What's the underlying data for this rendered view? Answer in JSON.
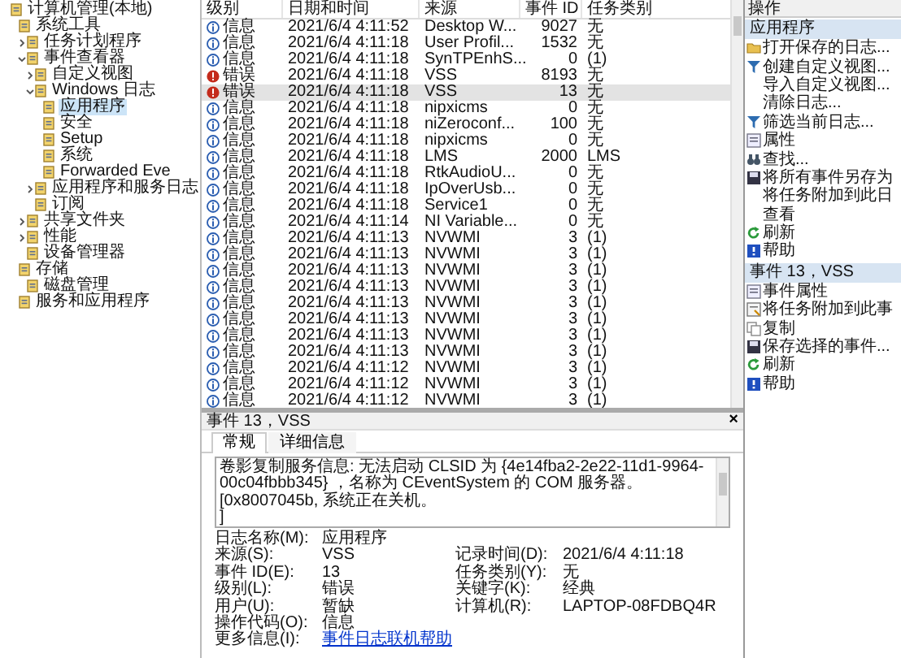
{
  "tree": [
    {
      "label": "计算机管理(本地)",
      "selected": false,
      "children": [
        {
          "label": "系统工具",
          "selected": false,
          "children": [
            {
              "label": "任务计划程序",
              "expanded": false,
              "selected": false
            },
            {
              "label": "事件查看器",
              "expanded": true,
              "selected": false,
              "children": [
                {
                  "label": "自定义视图",
                  "expanded": false,
                  "selected": false
                },
                {
                  "label": "Windows 日志",
                  "expanded": true,
                  "selected": false,
                  "children": [
                    {
                      "label": "应用程序",
                      "selected": true
                    },
                    {
                      "label": "安全",
                      "selected": false
                    },
                    {
                      "label": "Setup",
                      "selected": false
                    },
                    {
                      "label": "系统",
                      "selected": false
                    },
                    {
                      "label": "Forwarded Eve",
                      "selected": false
                    }
                  ]
                },
                {
                  "label": "应用程序和服务日志",
                  "expanded": false,
                  "selected": false
                },
                {
                  "label": "订阅",
                  "selected": false
                }
              ]
            },
            {
              "label": "共享文件夹",
              "expanded": false,
              "selected": false
            },
            {
              "label": "性能",
              "expanded": false,
              "selected": false
            },
            {
              "label": "设备管理器",
              "selected": false
            }
          ]
        },
        {
          "label": "存储",
          "selected": false,
          "children": [
            {
              "label": "磁盘管理",
              "selected": false
            }
          ]
        },
        {
          "label": "服务和应用程序",
          "selected": false
        }
      ]
    }
  ],
  "events": {
    "columns": [
      "级别",
      "日期和时间",
      "来源",
      "事件 ID",
      "任务类别"
    ],
    "rows": [
      {
        "kind": "info",
        "level": "信息",
        "time": "2021/6/4 4:11:52",
        "source": "Desktop W...",
        "id": "9027",
        "category": "无",
        "selected": false
      },
      {
        "kind": "info",
        "level": "信息",
        "time": "2021/6/4 4:11:18",
        "source": "User Profil...",
        "id": "1532",
        "category": "无",
        "selected": false
      },
      {
        "kind": "info",
        "level": "信息",
        "time": "2021/6/4 4:11:18",
        "source": "SynTPEnhS...",
        "id": "0",
        "category": "(1)",
        "selected": false
      },
      {
        "kind": "error",
        "level": "错误",
        "time": "2021/6/4 4:11:18",
        "source": "VSS",
        "id": "8193",
        "category": "无",
        "selected": false
      },
      {
        "kind": "error",
        "level": "错误",
        "time": "2021/6/4 4:11:18",
        "source": "VSS",
        "id": "13",
        "category": "无",
        "selected": true
      },
      {
        "kind": "info",
        "level": "信息",
        "time": "2021/6/4 4:11:18",
        "source": "nipxicms",
        "id": "0",
        "category": "无",
        "selected": false
      },
      {
        "kind": "info",
        "level": "信息",
        "time": "2021/6/4 4:11:18",
        "source": "niZeroconf...",
        "id": "100",
        "category": "无",
        "selected": false
      },
      {
        "kind": "info",
        "level": "信息",
        "time": "2021/6/4 4:11:18",
        "source": "nipxicms",
        "id": "0",
        "category": "无",
        "selected": false
      },
      {
        "kind": "info",
        "level": "信息",
        "time": "2021/6/4 4:11:18",
        "source": "LMS",
        "id": "2000",
        "category": "LMS",
        "selected": false
      },
      {
        "kind": "info",
        "level": "信息",
        "time": "2021/6/4 4:11:18",
        "source": "RtkAudioU...",
        "id": "0",
        "category": "无",
        "selected": false
      },
      {
        "kind": "info",
        "level": "信息",
        "time": "2021/6/4 4:11:18",
        "source": "IpOverUsb...",
        "id": "0",
        "category": "无",
        "selected": false
      },
      {
        "kind": "info",
        "level": "信息",
        "time": "2021/6/4 4:11:18",
        "source": "Service1",
        "id": "0",
        "category": "无",
        "selected": false
      },
      {
        "kind": "info",
        "level": "信息",
        "time": "2021/6/4 4:11:14",
        "source": "NI Variable...",
        "id": "0",
        "category": "无",
        "selected": false
      },
      {
        "kind": "info",
        "level": "信息",
        "time": "2021/6/4 4:11:13",
        "source": "NVWMI",
        "id": "3",
        "category": "(1)",
        "selected": false
      },
      {
        "kind": "info",
        "level": "信息",
        "time": "2021/6/4 4:11:13",
        "source": "NVWMI",
        "id": "3",
        "category": "(1)",
        "selected": false
      },
      {
        "kind": "info",
        "level": "信息",
        "time": "2021/6/4 4:11:13",
        "source": "NVWMI",
        "id": "3",
        "category": "(1)",
        "selected": false
      },
      {
        "kind": "info",
        "level": "信息",
        "time": "2021/6/4 4:11:13",
        "source": "NVWMI",
        "id": "3",
        "category": "(1)",
        "selected": false
      },
      {
        "kind": "info",
        "level": "信息",
        "time": "2021/6/4 4:11:13",
        "source": "NVWMI",
        "id": "3",
        "category": "(1)",
        "selected": false
      },
      {
        "kind": "info",
        "level": "信息",
        "time": "2021/6/4 4:11:13",
        "source": "NVWMI",
        "id": "3",
        "category": "(1)",
        "selected": false
      },
      {
        "kind": "info",
        "level": "信息",
        "time": "2021/6/4 4:11:13",
        "source": "NVWMI",
        "id": "3",
        "category": "(1)",
        "selected": false
      },
      {
        "kind": "info",
        "level": "信息",
        "time": "2021/6/4 4:11:13",
        "source": "NVWMI",
        "id": "3",
        "category": "(1)",
        "selected": false
      },
      {
        "kind": "info",
        "level": "信息",
        "time": "2021/6/4 4:11:12",
        "source": "NVWMI",
        "id": "3",
        "category": "(1)",
        "selected": false
      },
      {
        "kind": "info",
        "level": "信息",
        "time": "2021/6/4 4:11:12",
        "source": "NVWMI",
        "id": "3",
        "category": "(1)",
        "selected": false
      },
      {
        "kind": "info",
        "level": "信息",
        "time": "2021/6/4 4:11:12",
        "source": "NVWMI",
        "id": "3",
        "category": "(1)",
        "selected": false
      }
    ]
  },
  "detail": {
    "title": "事件 13，VSS",
    "close": "×",
    "tabs": [
      {
        "label": "常规",
        "selected": true
      },
      {
        "label": "详细信息",
        "selected": false
      }
    ],
    "message": [
      "卷影复制服务信息: 无法启动 CLSID 为 {4e14fba2-2e22-11d1-9964-00c04fbbb345} ，名称为 CEventSystem 的 COM 服务器。[0x8007045b, 系统正在关机。",
      "]"
    ],
    "rows": [
      {
        "left": {
          "label": "日志名称(M):",
          "value": "应用程序",
          "kind": "text"
        }
      },
      {
        "left": {
          "label": "来源(S):",
          "value": "VSS",
          "kind": "text"
        },
        "right": {
          "label": "记录时间(D):",
          "value": "2021/6/4 4:11:18",
          "kind": "text"
        }
      },
      {
        "left": {
          "label": "事件 ID(E):",
          "value": "13",
          "kind": "text"
        },
        "right": {
          "label": "任务类别(Y):",
          "value": "无",
          "kind": "text"
        }
      },
      {
        "left": {
          "label": "级别(L):",
          "value": "错误",
          "kind": "text"
        },
        "right": {
          "label": "关键字(K):",
          "value": "经典",
          "kind": "text"
        }
      },
      {
        "left": {
          "label": "用户(U):",
          "value": "暂缺",
          "kind": "text"
        },
        "right": {
          "label": "计算机(R):",
          "value": "LAPTOP-08FDBQ4R",
          "kind": "text"
        }
      },
      {
        "left": {
          "label": "操作代码(O):",
          "value": "信息",
          "kind": "text"
        }
      },
      {
        "left": {
          "label": "更多信息(I):",
          "value": "事件日志联机帮助",
          "kind": "link"
        }
      }
    ]
  },
  "actions": {
    "title": "操作",
    "sections": [
      {
        "title": "应用程序",
        "items": [
          {
            "label": "打开保存的日志...",
            "kind": "folder"
          },
          {
            "label": "创建自定义视图...",
            "kind": "filter"
          },
          {
            "label": "导入自定义视图...",
            "kind": "none"
          },
          {
            "label": "清除日志...",
            "kind": "none"
          },
          {
            "label": "筛选当前日志...",
            "kind": "filter"
          },
          {
            "label": "属性",
            "kind": "properties"
          },
          {
            "label": "查找...",
            "kind": "find"
          },
          {
            "label": "将所有事件另存为",
            "kind": "save"
          },
          {
            "label": "将任务附加到此日",
            "kind": "none"
          },
          {
            "label": "查看",
            "kind": "none"
          },
          {
            "label": "刷新",
            "kind": "refresh"
          },
          {
            "label": "帮助",
            "kind": "help"
          }
        ]
      },
      {
        "title": "事件 13，VSS",
        "items": [
          {
            "label": "事件属性",
            "kind": "properties"
          },
          {
            "label": "将任务附加到此事",
            "kind": "task"
          },
          {
            "label": "复制",
            "kind": "copy"
          },
          {
            "label": "保存选择的事件...",
            "kind": "save"
          },
          {
            "label": "刷新",
            "kind": "refresh"
          },
          {
            "label": "帮助",
            "kind": "help"
          }
        ]
      }
    ]
  }
}
